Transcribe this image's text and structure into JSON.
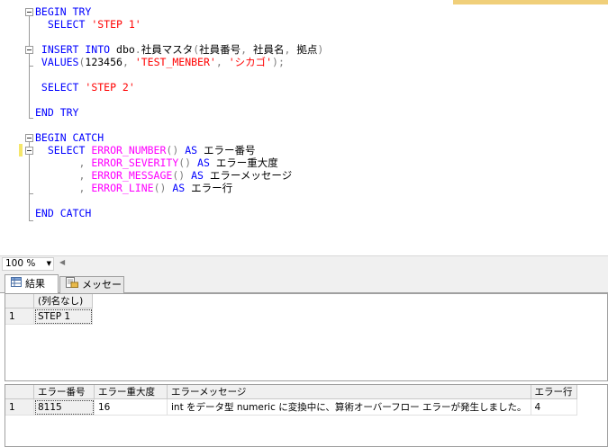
{
  "editor": {
    "lines": [
      [
        {
          "t": "BEGIN TRY",
          "c": "kw"
        }
      ],
      [
        {
          "t": "  SELECT ",
          "c": "kw"
        },
        {
          "t": "'STEP 1'",
          "c": "str"
        }
      ],
      [],
      [
        {
          "t": " INSERT INTO ",
          "c": "kw"
        },
        {
          "t": "dbo",
          "c": "plain"
        },
        {
          "t": ".",
          "c": "gray"
        },
        {
          "t": "社員マスタ",
          "c": "plain"
        },
        {
          "t": "(",
          "c": "gray"
        },
        {
          "t": "社員番号",
          "c": "plain"
        },
        {
          "t": ", ",
          "c": "gray"
        },
        {
          "t": "社員名",
          "c": "plain"
        },
        {
          "t": ", ",
          "c": "gray"
        },
        {
          "t": "拠点",
          "c": "plain"
        },
        {
          "t": ")",
          "c": "gray"
        }
      ],
      [
        {
          "t": " VALUES",
          "c": "kw"
        },
        {
          "t": "(",
          "c": "gray"
        },
        {
          "t": "123456",
          "c": "plain"
        },
        {
          "t": ", ",
          "c": "gray"
        },
        {
          "t": "'TEST_MENBER'",
          "c": "str"
        },
        {
          "t": ", ",
          "c": "gray"
        },
        {
          "t": "'シカゴ'",
          "c": "str"
        },
        {
          "t": ");",
          "c": "gray"
        }
      ],
      [],
      [
        {
          "t": " SELECT ",
          "c": "kw"
        },
        {
          "t": "'STEP 2'",
          "c": "str"
        }
      ],
      [],
      [
        {
          "t": "END TRY",
          "c": "kw"
        }
      ],
      [],
      [
        {
          "t": "BEGIN CATCH",
          "c": "kw"
        }
      ],
      [
        {
          "t": "  SELECT ",
          "c": "kw"
        },
        {
          "t": "ERROR_NUMBER",
          "c": "fn"
        },
        {
          "t": "() ",
          "c": "gray"
        },
        {
          "t": "AS ",
          "c": "kw"
        },
        {
          "t": "エラー番号",
          "c": "plain"
        }
      ],
      [
        {
          "t": "       , ",
          "c": "gray"
        },
        {
          "t": "ERROR_SEVERITY",
          "c": "fn"
        },
        {
          "t": "() ",
          "c": "gray"
        },
        {
          "t": "AS ",
          "c": "kw"
        },
        {
          "t": "エラー重大度",
          "c": "plain"
        }
      ],
      [
        {
          "t": "       , ",
          "c": "gray"
        },
        {
          "t": "ERROR_MESSAGE",
          "c": "fn"
        },
        {
          "t": "() ",
          "c": "gray"
        },
        {
          "t": "AS ",
          "c": "kw"
        },
        {
          "t": "エラーメッセージ",
          "c": "plain"
        }
      ],
      [
        {
          "t": "       , ",
          "c": "gray"
        },
        {
          "t": "ERROR_LINE",
          "c": "fn"
        },
        {
          "t": "() ",
          "c": "gray"
        },
        {
          "t": "AS ",
          "c": "kw"
        },
        {
          "t": "エラー行",
          "c": "plain"
        }
      ],
      [],
      [
        {
          "t": "END CATCH",
          "c": "kw"
        }
      ]
    ]
  },
  "zoom": {
    "value": "100 %"
  },
  "tabs": {
    "results": "結果",
    "messages": "メッセージ"
  },
  "grid1": {
    "columns": [
      "(列名なし)"
    ],
    "rows": [
      {
        "num": "1",
        "cells": [
          "STEP 1"
        ]
      }
    ]
  },
  "grid2": {
    "columns": [
      "エラー番号",
      "エラー重大度",
      "エラーメッセージ",
      "エラー行"
    ],
    "rows": [
      {
        "num": "1",
        "cells": [
          "8115",
          "16",
          "int をデータ型 numeric に変換中に、算術オーバーフロー エラーが発生しました。",
          "4"
        ]
      }
    ]
  },
  "colors": {
    "keyword": "#0000ff",
    "string": "#ff0000",
    "function": "#ff00ff",
    "operator": "#808080"
  }
}
